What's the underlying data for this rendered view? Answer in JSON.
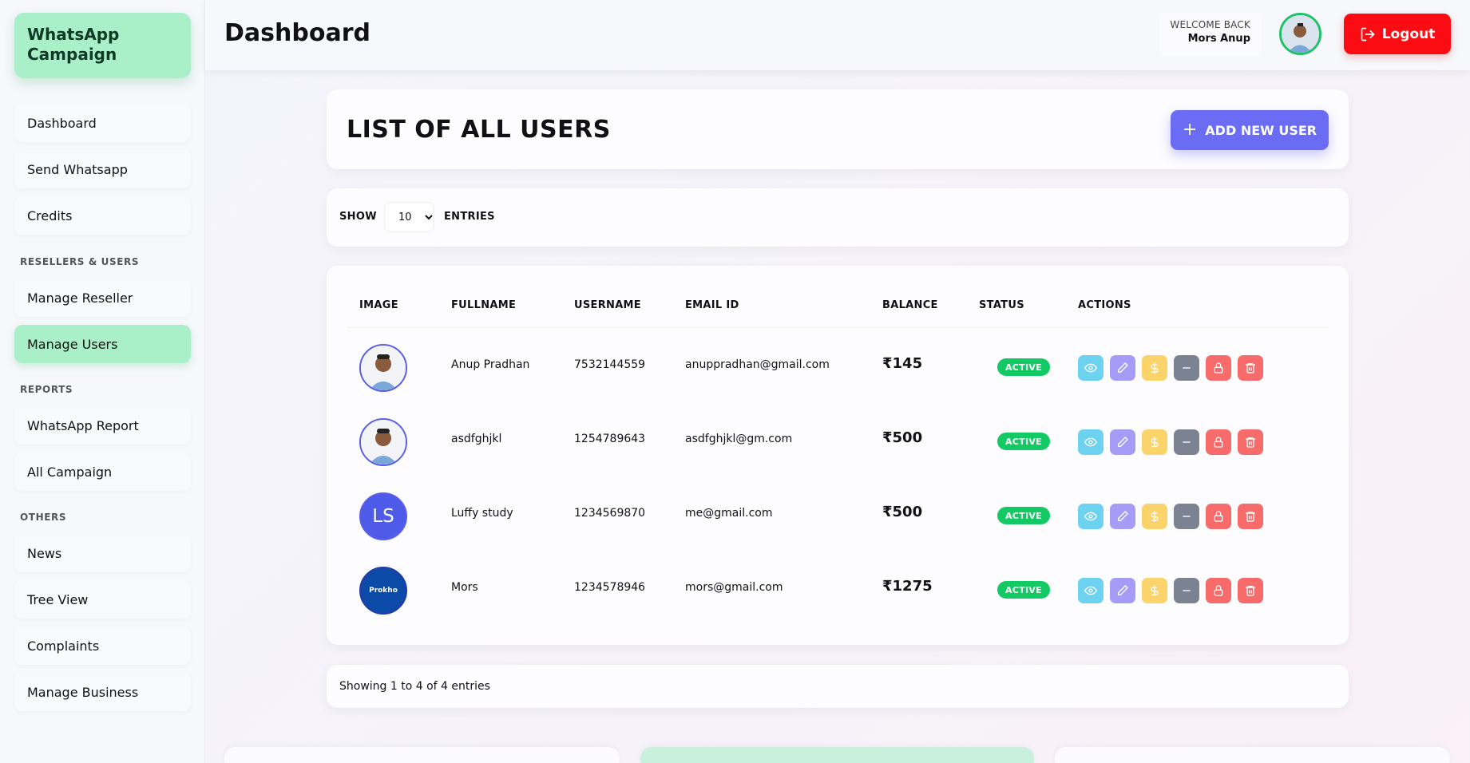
{
  "sidebar": {
    "brand": "WhatsApp Campaign",
    "items": [
      {
        "label": "Dashboard"
      },
      {
        "label": "Send Whatsapp"
      },
      {
        "label": "Credits"
      },
      {
        "label": "Manage Reseller"
      },
      {
        "label": "Manage Users"
      },
      {
        "label": "WhatsApp Report"
      },
      {
        "label": "All Campaign"
      },
      {
        "label": "News"
      },
      {
        "label": "Tree View"
      },
      {
        "label": "Complaints"
      },
      {
        "label": "Manage Business"
      }
    ],
    "sections": [
      "RESELLERS & USERS",
      "REPORTS",
      "OTHERS"
    ],
    "active_item": "Manage Users"
  },
  "header": {
    "title": "Dashboard",
    "welcome_label": "WELCOME BACK",
    "user_name": "Mors Anup",
    "logout_label": "Logout"
  },
  "users": {
    "title": "LIST OF ALL USERS",
    "add_button": "ADD NEW USER",
    "show_label": "SHOW",
    "entries_value": "10",
    "entries_label": "ENTRIES",
    "columns": [
      "IMAGE",
      "FULLNAME",
      "USERNAME",
      "EMAIL ID",
      "BALANCE",
      "STATUS",
      "ACTIONS"
    ],
    "rows": [
      {
        "fullname": "Anup Pradhan",
        "username": "7532144559",
        "email": "anuppradhan@gmail.com",
        "balance": "₹145",
        "status": "ACTIVE",
        "avatar": "photo"
      },
      {
        "fullname": "asdfghjkl",
        "username": "1254789643",
        "email": "asdfghjkl@gm.com",
        "balance": "₹500",
        "status": "ACTIVE",
        "avatar": "photo"
      },
      {
        "fullname": "Luffy study",
        "username": "1234569870",
        "email": "me@gmail.com",
        "balance": "₹500",
        "status": "ACTIVE",
        "avatar": "LS"
      },
      {
        "fullname": "Mors",
        "username": "1234578946",
        "email": "mors@gmail.com",
        "balance": "₹1275",
        "status": "ACTIVE",
        "avatar": "Prokho"
      }
    ],
    "footer": "Showing 1 to 4 of 4 entries"
  },
  "colors": {
    "accent_green": "#a9f0c9",
    "primary": "#6a6cf4",
    "logout": "#fb0b12",
    "active_badge": "#13c964"
  }
}
